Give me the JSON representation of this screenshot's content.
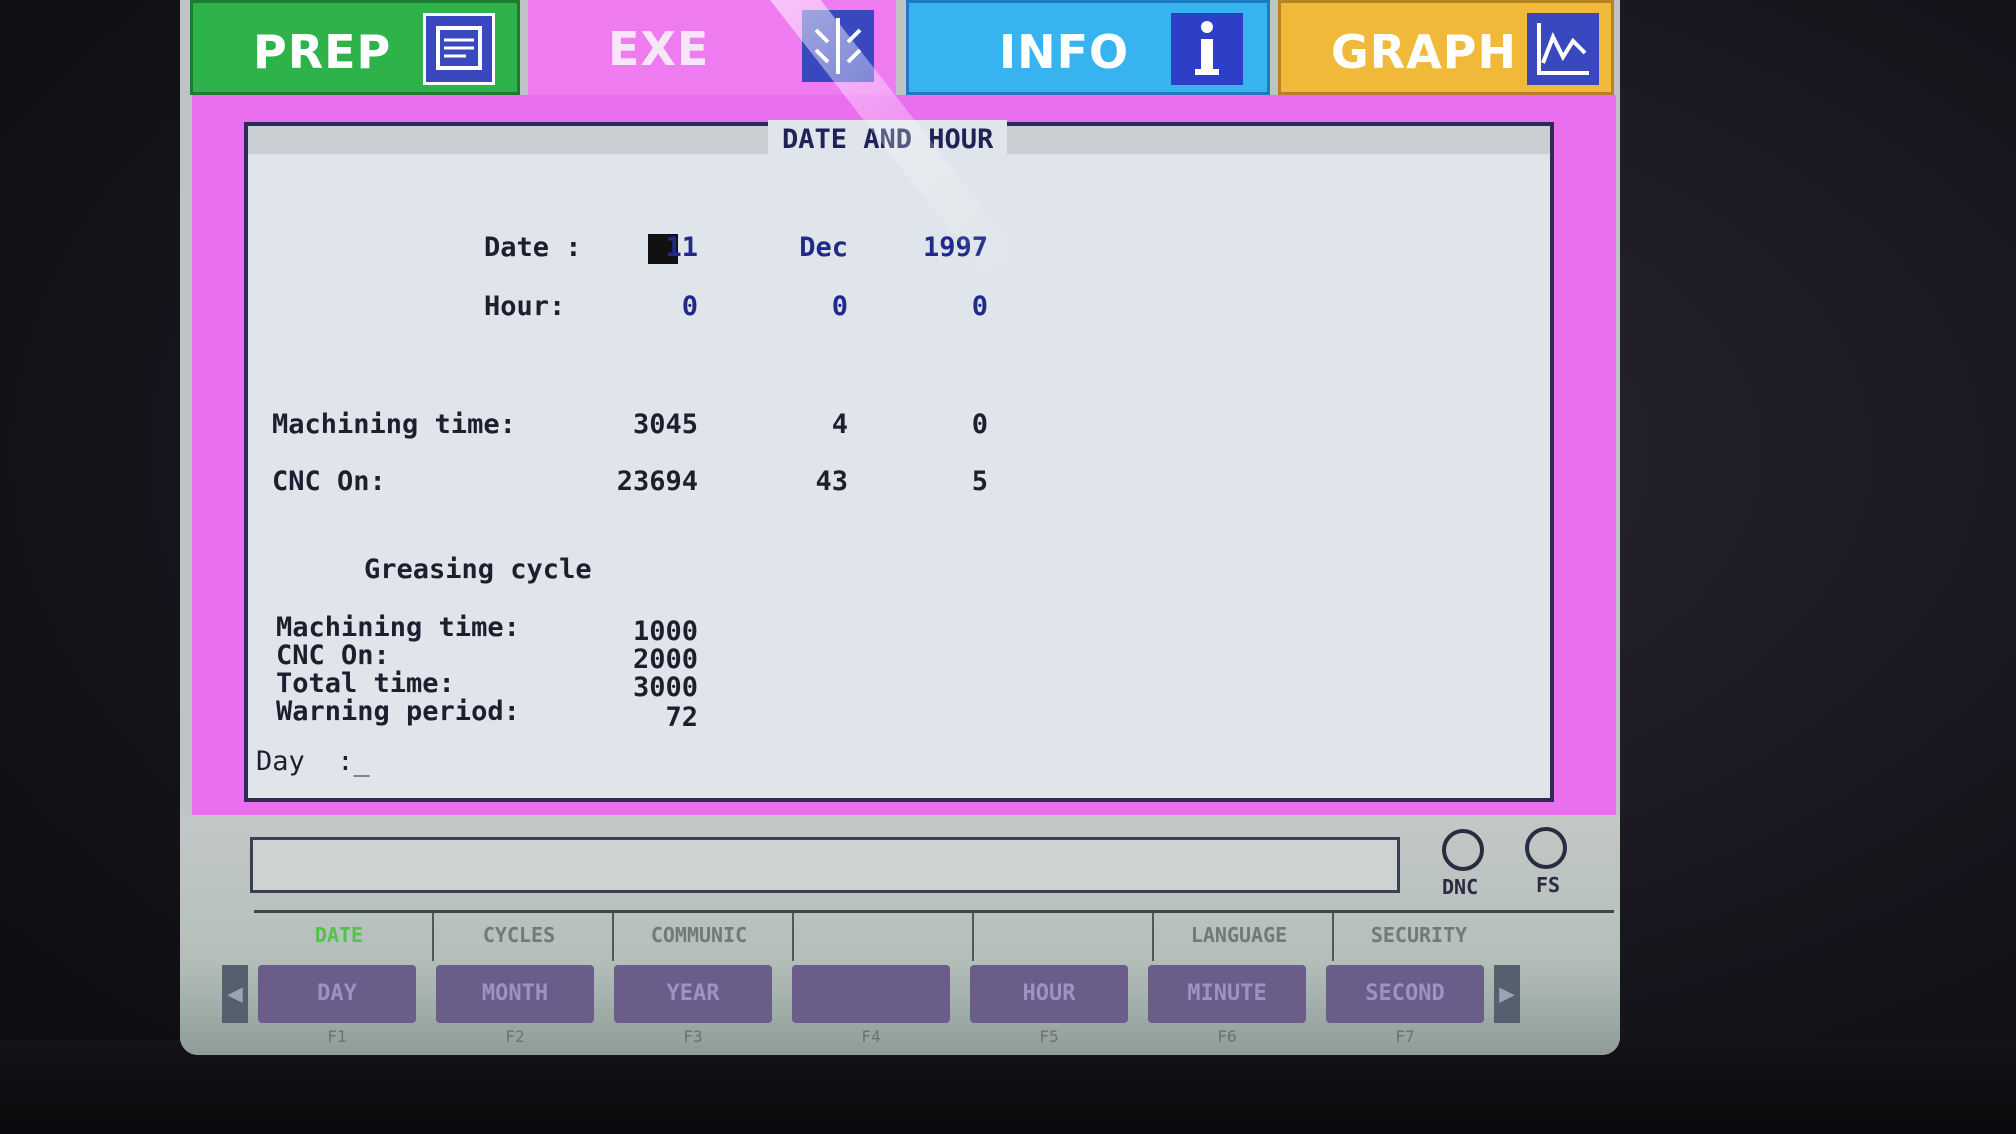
{
  "tabs": {
    "prep": "PREP",
    "exe": "EXE",
    "info": "INFO",
    "graph": "GRAPH"
  },
  "panel": {
    "title": "DATE AND HOUR",
    "date_label": "Date :",
    "date_day": "11",
    "date_month": "Dec",
    "date_year": "1997",
    "hour_label": "Hour:",
    "hour_h": "0",
    "hour_m": "0",
    "hour_s": "0",
    "machining_label": "Machining time:",
    "machining_h": "3045",
    "machining_m": "4",
    "machining_s": "0",
    "cnc_label": "CNC On:",
    "cnc_h": "23694",
    "cnc_m": "43",
    "cnc_s": "5",
    "greasing_title": "Greasing cycle",
    "g_machining_label": "Machining time:",
    "g_machining_val": "1000",
    "g_cnc_label": "CNC On:",
    "g_cnc_val": "2000",
    "g_total_label": "Total time:",
    "g_total_val": "3000",
    "g_warning_label": "Warning period:",
    "g_warning_val": "72",
    "prompt": "Day  :_"
  },
  "indicators": {
    "dnc": "DNC",
    "fs": "FS"
  },
  "menu": [
    "DATE",
    "CYCLES",
    "COMMUNIC",
    "",
    "",
    "LANGUAGE",
    "SECURITY"
  ],
  "softkeys": [
    "DAY",
    "MONTH",
    "YEAR",
    "",
    "HOUR",
    "MINUTE",
    "SECOND"
  ],
  "fkeys": [
    "F1",
    "F2",
    "F3",
    "F4",
    "F5",
    "F6",
    "F7"
  ],
  "colors": {
    "prep": "#2eb34a",
    "exe": "#ee7cf0",
    "info": "#37b4f0",
    "graph": "#f0b93a"
  }
}
